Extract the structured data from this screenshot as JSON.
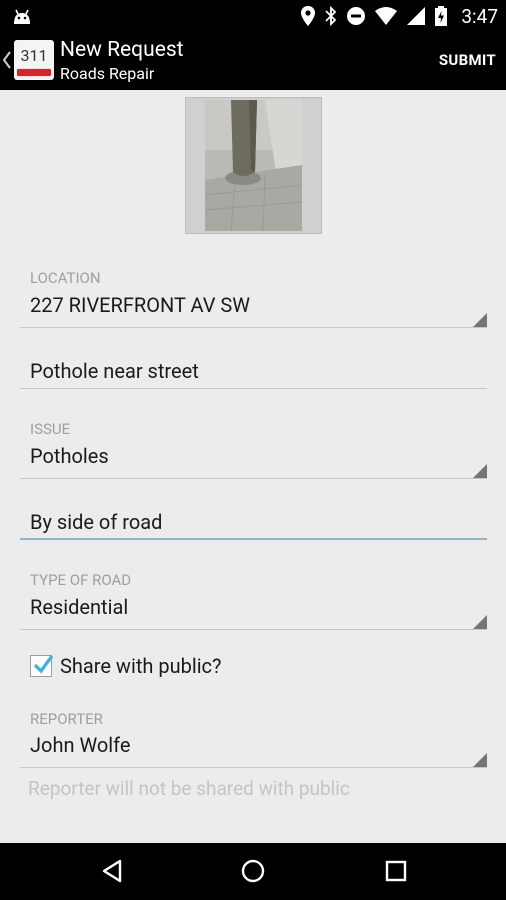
{
  "status_bar": {
    "time": "3:47",
    "icons": [
      "location-icon",
      "bluetooth-icon",
      "do-not-disturb-icon",
      "wifi-icon",
      "battery-icon"
    ]
  },
  "action_bar": {
    "app_logo_text": "311",
    "title": "New Request",
    "subtitle": "Roads Repair",
    "submit_label": "SUBMIT"
  },
  "form": {
    "location": {
      "label": "LOCATION",
      "value": "227 RIVERFRONT AV SW"
    },
    "description": {
      "value": "Pothole near street"
    },
    "issue": {
      "label": "ISSUE",
      "value": "Potholes"
    },
    "issue_detail": {
      "value": "By side of road"
    },
    "type_of_road": {
      "label": "TYPE OF ROAD",
      "value": "Residential"
    },
    "share": {
      "label": "Share with public?",
      "checked": true
    },
    "reporter": {
      "label": "REPORTER",
      "value": "John Wolfe",
      "helper": "Reporter will not be shared with public"
    }
  },
  "colors": {
    "accent": "#33b5e5",
    "active_underline": "#8fb8cf",
    "background": "#ececec"
  }
}
